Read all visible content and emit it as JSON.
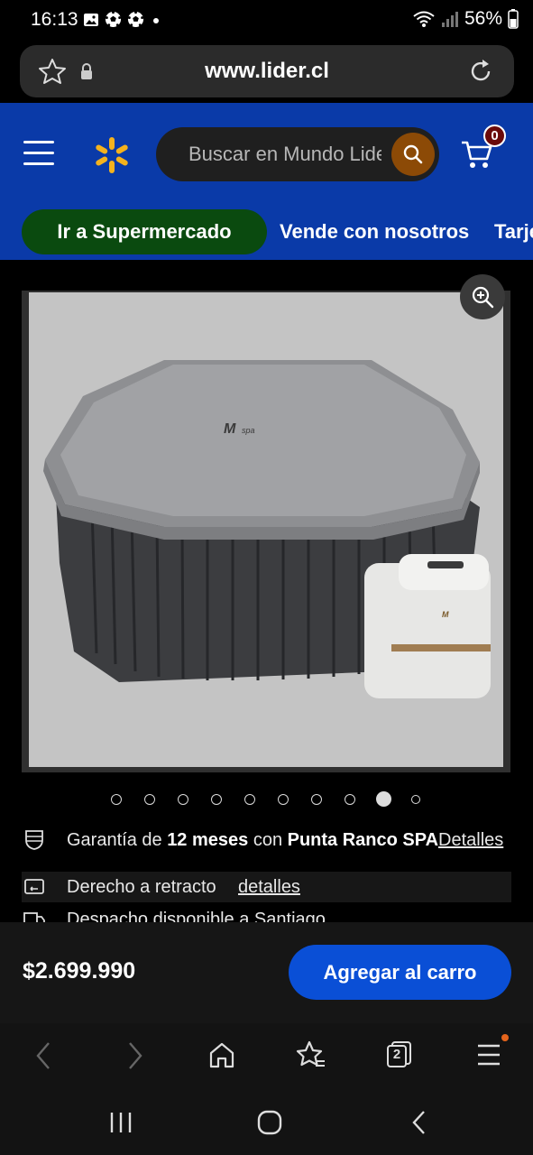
{
  "status_bar": {
    "time": "16:13",
    "battery": "56%",
    "icons": [
      "gallery-icon",
      "soccer-ball-icon",
      "soccer-ball-icon",
      "dot-icon",
      "wifi-icon",
      "signal-icon",
      "battery-icon"
    ]
  },
  "browser": {
    "url": "www.lider.cl",
    "tabs_count": "2"
  },
  "header": {
    "search_placeholder": "Buscar en Mundo Lider",
    "cart_count": "0",
    "brand_color": "#0a3aa8",
    "spark_color": "#f4b21e"
  },
  "nav": {
    "supermarket_label": "Ir a Supermercado",
    "links": [
      "Vende con nosotros",
      "Tarjeta"
    ]
  },
  "product": {
    "image_count": 10,
    "active_image_index": 8
  },
  "info": {
    "warranty_prefix": "Garantía de ",
    "warranty_months": "12 meses",
    "warranty_mid": " con ",
    "warranty_seller": "Punta Ranco SPA",
    "warranty_link": "Detalles",
    "return_text": "Derecho a retracto",
    "return_link": "detalles",
    "shipping_text": "Despacho disponible a Santiago"
  },
  "buy": {
    "price": "$2.699.990",
    "add_to_cart": "Agregar al carro",
    "button_color": "#0a4fd6"
  }
}
